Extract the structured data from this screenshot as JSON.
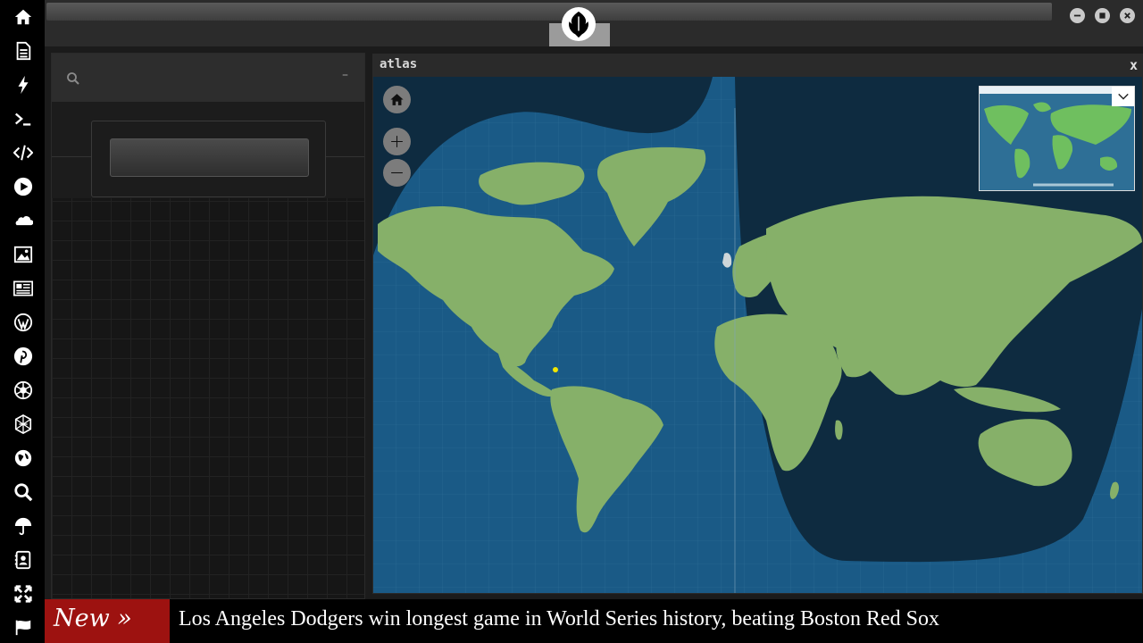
{
  "dock": {
    "items": [
      "home-icon",
      "document-icon",
      "lightning-icon",
      "terminal-icon",
      "code-icon",
      "play-icon",
      "cloud-icon",
      "image-icon",
      "newspaper-icon",
      "wordpress-icon",
      "pinterest-icon",
      "rebel-icon",
      "globe-mesh-icon",
      "globe-icon",
      "search-icon",
      "umbrella-icon",
      "contacts-icon",
      "expand-icon",
      "flag-icon"
    ]
  },
  "window": {
    "title": "atlas",
    "close_label": "x"
  },
  "left_panel": {
    "minimize_label": "–"
  },
  "ticker": {
    "tag": "New »",
    "headline": "Los Angeles Dodgers win longest game in World Series history, beating Boston Red Sox"
  },
  "colors": {
    "ocean": "#1a5a86",
    "night": "#0e2b40",
    "land": "#86b069",
    "ticker_tag": "#9d1210",
    "marker": "#f2e600"
  }
}
